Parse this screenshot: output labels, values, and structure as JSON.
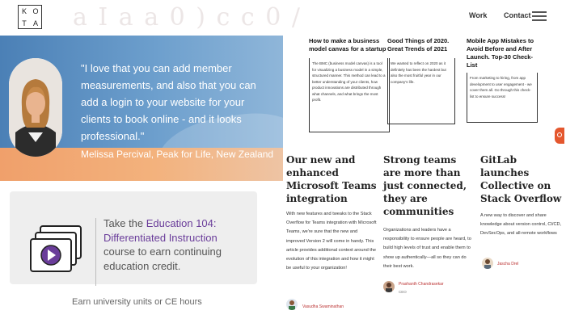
{
  "header": {
    "logo_letters": [
      "K",
      "O",
      "T",
      "A"
    ],
    "watermark": "a I a a 0 ) c c 0 /",
    "nav_work": "Work",
    "nav_contact": "Contact"
  },
  "testimonial": {
    "quote": "\"I love that you can add member measurements, and also that you can add a login to your website for your clients to book online - and it looks professional.\"",
    "author": "Melissa Percival, Peak for Life, New Zealand"
  },
  "education": {
    "text_1": "Take the ",
    "highlight": "Education 104: Differentiated Instruction",
    "text_2": " course to earn continuing education credit.",
    "footer": "Earn university units or CE hours",
    "icon_color": "#6a3d9a"
  },
  "top_cards": [
    {
      "title": "How to make a business model canvas for a startup",
      "body": "The BMC (business model canvas) is a tool for visualizing a business model in a simple, structured manner. This method can lead to a better understanding of your clients, how product innovations are distributed through what channels, and what brings the most profit."
    },
    {
      "title": "Good Things of 2020. Great Trends of 2021",
      "body": "We wanted to reflect on 2020 as it definitely has been the hardest but also the most fruitful year in our company's life."
    },
    {
      "title": "Mobile App Mistakes to Avoid Before and After Launch. Top-30 Check-List",
      "body": "From marketing to hiring, from app development to user engagement - we cover them all. Go through this check-list to ensure success!"
    }
  ],
  "articles": [
    {
      "title": "Our new and enhanced Microsoft Teams integration",
      "body": "With new features and tweaks to the Stack Overflow for Teams integration with Microsoft Teams, we're sure that the new and improved Version 2 will come in handy. This article provides additional context around the evolution of this integration and how it might be useful to your organization!",
      "author": "Vasudha Swaminathan",
      "role": ""
    },
    {
      "title": "Strong teams are more than just connected, they are communities",
      "body": "Organizations and leaders have a responsibility to ensure people are heard, to build high levels of trust and enable them to show up authentically—all so they can do their best work.",
      "author": "Prashanth Chandrasekar",
      "role": "CEO"
    },
    {
      "title": "GitLab launches Collective on Stack Overflow",
      "body": "A new way to discover and share knowledge about version control, CI/CD, DevSecOps, and all-remote workflows",
      "author": "Jascha Drel",
      "role": ""
    }
  ],
  "colors": {
    "accent_purple": "#6a3d9a",
    "author_link": "#b33333",
    "chat_badge": "#e4572e"
  }
}
